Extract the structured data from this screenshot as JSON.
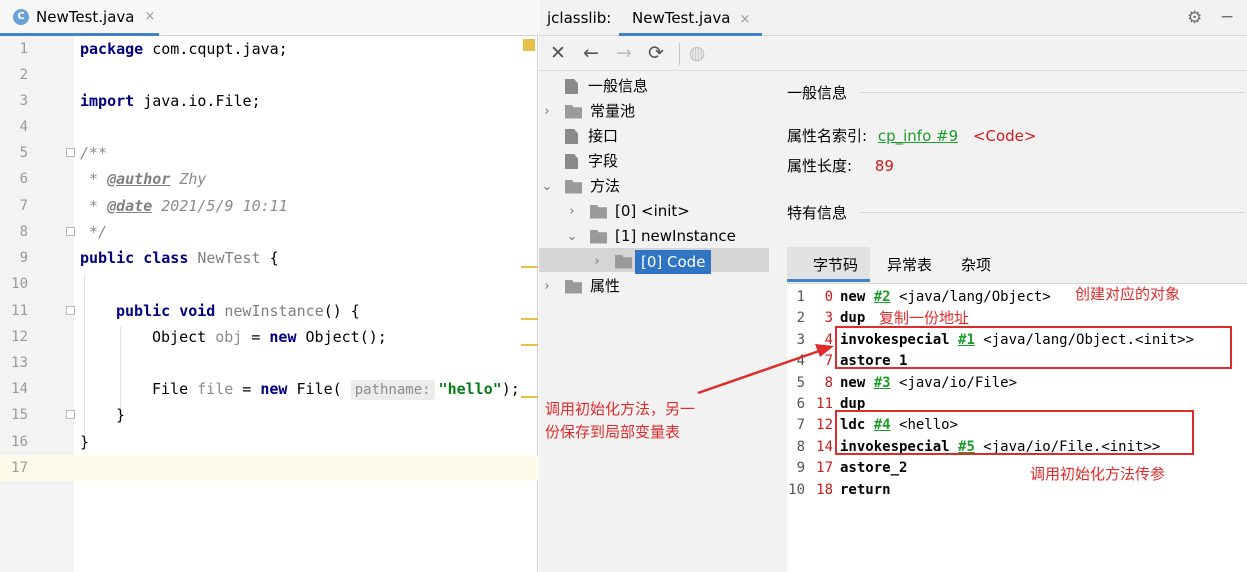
{
  "editor": {
    "tab_label": "NewTest.java",
    "tab_icon": "C",
    "close_glyph": "×",
    "line_numbers": [
      "1",
      "2",
      "3",
      "4",
      "5",
      "6",
      "7",
      "8",
      "9",
      "10",
      "11",
      "12",
      "13",
      "14",
      "15",
      "16",
      "17"
    ],
    "code": {
      "l1_kw": "package",
      "l1_rest": " com.cqupt.java;",
      "l3_kw": "import",
      "l3_rest": " java.io.File;",
      "l5": "/**",
      "l6_pre": " * ",
      "l6_tag": "@author",
      "l6_val": " Zhy",
      "l7_pre": " * ",
      "l7_tag": "@date",
      "l7_val": " 2021/5/9 10:11",
      "l8": " */",
      "l9_kw": "public class",
      "l9_name": " NewTest",
      "l9_rest": " {",
      "l11_kw": "public void",
      "l11_name": " newInstance",
      "l11_rest": "() {",
      "l12_a": "Object ",
      "l12_var": "obj",
      "l12_b": " = ",
      "l12_kw": "new",
      "l12_c": " Object();",
      "l14_a": "File ",
      "l14_var": "file",
      "l14_b": " = ",
      "l14_kw": "new",
      "l14_c": " File( ",
      "l14_hint": "pathname:",
      "l14_str": "\"hello\"",
      "l14_d": ");",
      "l15": "}",
      "l16": "}"
    }
  },
  "jclasslib": {
    "label": "jclasslib:",
    "tab_label": "NewTest.java",
    "close_glyph": "×",
    "settings_glyph": "⚙",
    "minimize_glyph": "−",
    "toolbar": {
      "close": "✕",
      "back": "←",
      "forward": "→",
      "refresh": "⟳",
      "browser": "◍"
    },
    "tree": {
      "general": "一般信息",
      "constant_pool": "常量池",
      "interfaces": "接口",
      "fields": "字段",
      "methods": "方法",
      "m0": "[0] <init>",
      "m1": "[1] newInstance",
      "code": "[0] Code",
      "attributes": "属性"
    },
    "detail": {
      "general_title": "一般信息",
      "name_index_label": "属性名索引:",
      "name_index_link": "cp_info #9",
      "name_index_value": "<Code>",
      "length_label": "属性长度:",
      "length_value": "89",
      "specific_title": "特有信息",
      "tabs": [
        "字节码",
        "异常表",
        "杂项"
      ]
    },
    "bytecode": [
      {
        "n": "1",
        "off": "0",
        "op": "new",
        "ref": "#2",
        "arg": " <java/lang/Object>"
      },
      {
        "n": "2",
        "off": "3",
        "op": "dup",
        "ref": "",
        "arg": ""
      },
      {
        "n": "3",
        "off": "4",
        "op": "invokespecial",
        "ref": "#1",
        "arg": " <java/lang/Object.<init>>"
      },
      {
        "n": "4",
        "off": "7",
        "op": "astore_1",
        "ref": "",
        "arg": ""
      },
      {
        "n": "5",
        "off": "8",
        "op": "new",
        "ref": "#3",
        "arg": " <java/io/File>"
      },
      {
        "n": "6",
        "off": "11",
        "op": "dup",
        "ref": "",
        "arg": ""
      },
      {
        "n": "7",
        "off": "12",
        "op": "ldc",
        "ref": "#4",
        "arg": " <hello>"
      },
      {
        "n": "8",
        "off": "14",
        "op": "invokespecial",
        "ref": "#5",
        "arg": " <java/io/File.<init>>"
      },
      {
        "n": "9",
        "off": "17",
        "op": "astore_2",
        "ref": "",
        "arg": ""
      },
      {
        "n": "10",
        "off": "18",
        "op": "return",
        "ref": "",
        "arg": ""
      }
    ]
  },
  "annotations": {
    "create_object": "创建对应的对象",
    "duplicate_address": "复制一份地址",
    "init_and_store_line1": "调用初始化方法，另一",
    "init_and_store_line2": "份保存到局部变量表",
    "init_pass_param": "调用初始化方法传参",
    "color": "#e02b2b"
  }
}
